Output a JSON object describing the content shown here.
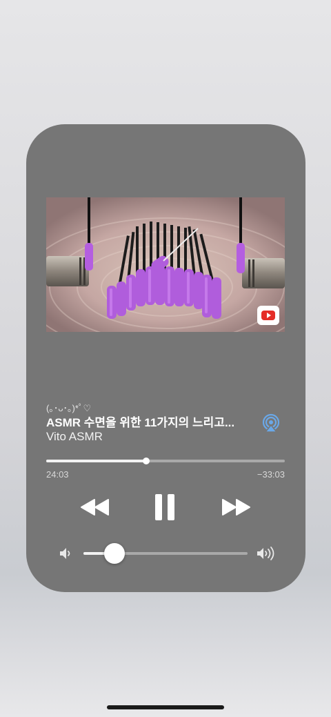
{
  "now_playing": {
    "kaomoji": "(｡･ᴗ･｡)*ﾟ♡",
    "title": "ASMR 수면을 위한 11가지의 느리고...",
    "artist": "Vito ASMR",
    "artwork_icon": "asmr-thumbnail",
    "source_icon": "youtube-icon"
  },
  "progress": {
    "elapsed": "24:03",
    "remaining": "−33:03",
    "fraction": 0.42
  },
  "controls": {
    "rewind_icon": "rewind-icon",
    "pause_icon": "pause-icon",
    "forward_icon": "fast-forward-icon",
    "airplay_icon": "airplay-audio-icon"
  },
  "volume": {
    "level": 0.19
  },
  "colors": {
    "card_bg": "#767676",
    "airplay_accent": "#6aa8e8",
    "youtube_red": "#e52d27"
  }
}
